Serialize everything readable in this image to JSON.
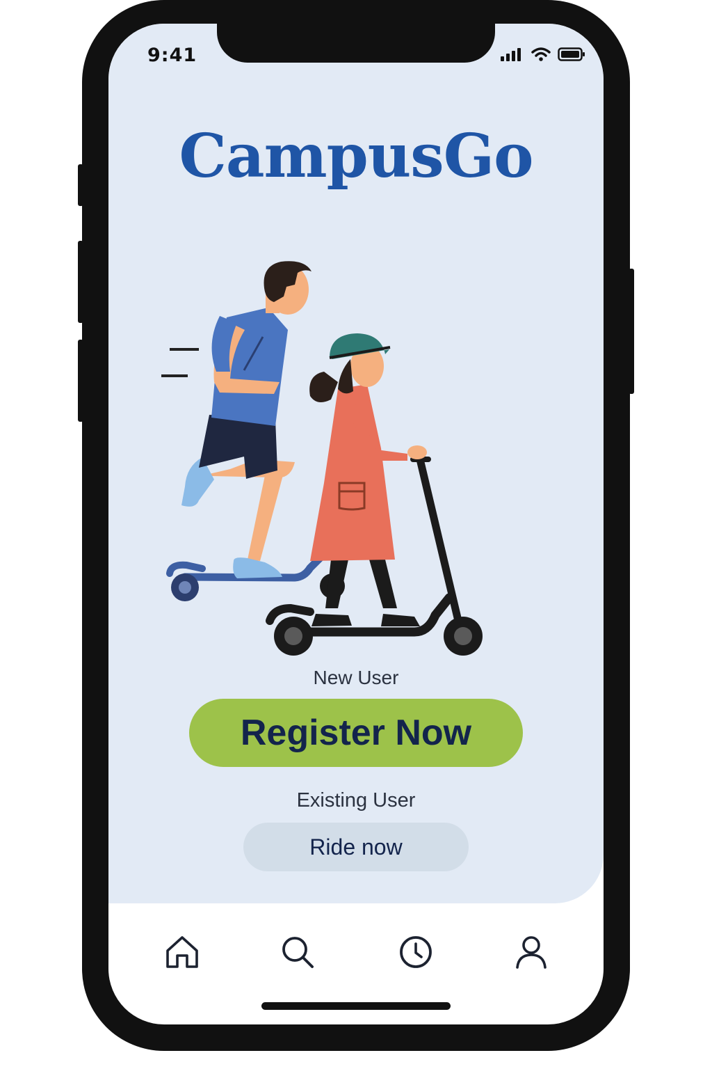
{
  "status_bar": {
    "time": "9:41",
    "icons": [
      "cellular-signal-icon",
      "wifi-icon",
      "battery-icon"
    ]
  },
  "app": {
    "logo_text": "CampusGo",
    "brand_color": "#1f55a6",
    "accent_color": "#9dc24a"
  },
  "illustration": {
    "description_icon": "scooter-riders-illustration"
  },
  "onboarding": {
    "new_user_label": "New User",
    "register_button": "Register Now",
    "existing_user_label": "Existing User",
    "ride_button": "Ride now"
  },
  "tab_bar": {
    "items": [
      {
        "icon": "home-icon"
      },
      {
        "icon": "search-icon"
      },
      {
        "icon": "clock-icon"
      },
      {
        "icon": "profile-icon"
      }
    ]
  }
}
